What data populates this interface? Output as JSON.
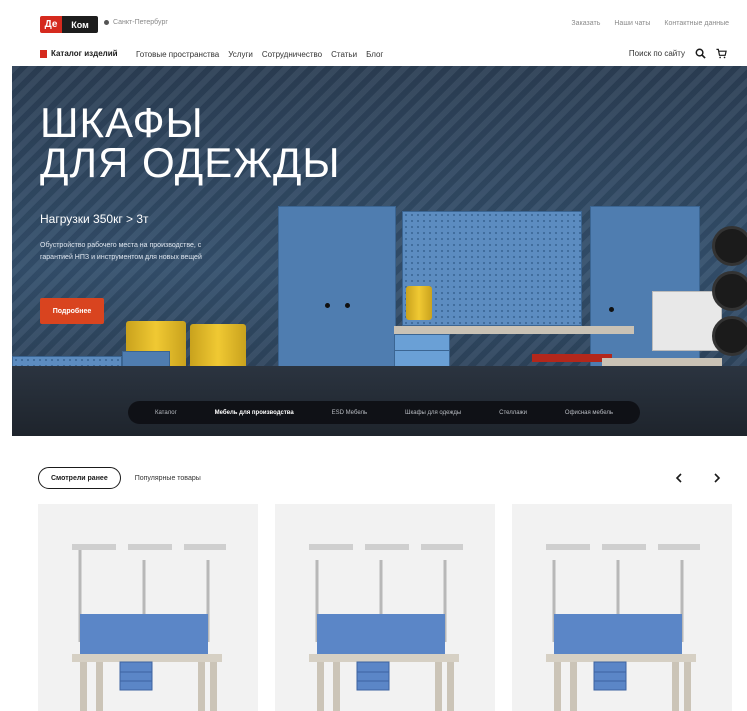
{
  "brand": {
    "logo_left": "Де",
    "logo_right": "Ком"
  },
  "header": {
    "city": "Санкт-Петербург",
    "links": [
      "Заказать",
      "Наши чаты",
      "Контактные данные"
    ]
  },
  "nav": {
    "catalog_label": "Каталог изделий",
    "links": [
      "Готовые пространства",
      "Услуги",
      "Сотрудничество",
      "Статьи",
      "Блог"
    ],
    "site_search_label": "Поиск по сайту"
  },
  "hero": {
    "title": "ШКАФЫ\nДЛЯ ОДЕЖДЫ",
    "subtitle": "Нагрузки 350кг > 3т",
    "description": "Обустройство рабочего места на производстве, с гарантией НПЗ и инструментом для новых вещей",
    "button_label": "Подробнее",
    "tabs": [
      {
        "label": "Каталог",
        "active": false
      },
      {
        "label": "Мебель для производства",
        "active": true
      },
      {
        "label": "ESD Мебель",
        "active": false
      },
      {
        "label": "Шкафы для одежды",
        "active": false
      },
      {
        "label": "Стеллажи",
        "active": false
      },
      {
        "label": "Офисная мебель",
        "active": false
      }
    ]
  },
  "products_section": {
    "tab_active": "Смотрели ранее",
    "tab_other": "Популярные товары",
    "prev_icon": "chevron-left-icon",
    "next_icon": "chevron-right-icon"
  },
  "colors": {
    "accent_red": "#d52a1e",
    "hero_button": "#d9441f",
    "cabinet_blue": "#4f7db0"
  },
  "icons": {
    "search": "search-icon",
    "cart": "cart-icon",
    "location": "pin-icon"
  }
}
